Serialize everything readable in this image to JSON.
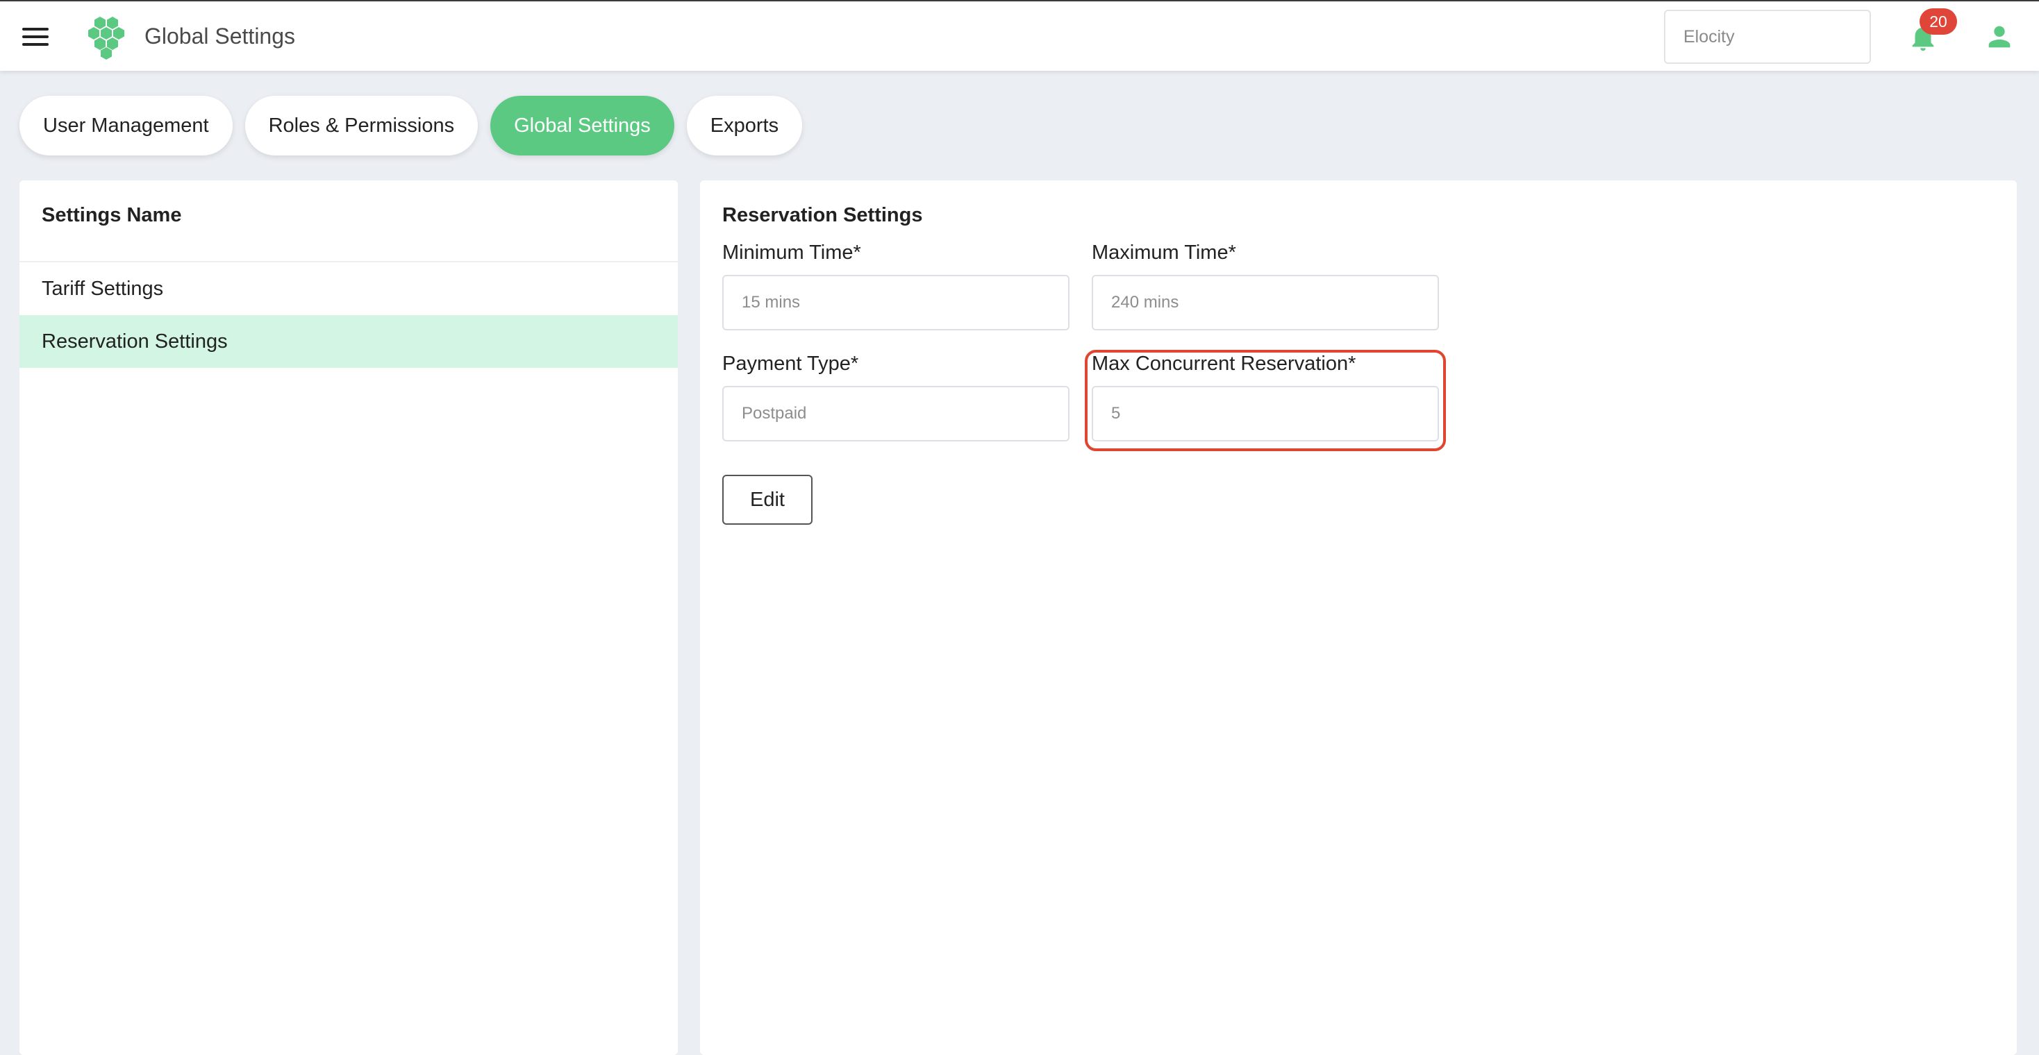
{
  "header": {
    "app_title": "Global Settings",
    "org_selector_value": "Elocity",
    "notification_count": "20",
    "brand_color": "#5cc983",
    "badge_color": "#e0453a",
    "icons": [
      "menu-icon",
      "logo-icon",
      "bell-icon",
      "user-icon"
    ]
  },
  "tabs": [
    {
      "label": "User Management",
      "active": false
    },
    {
      "label": "Roles & Permissions",
      "active": false
    },
    {
      "label": "Global Settings",
      "active": true
    },
    {
      "label": "Exports",
      "active": false
    }
  ],
  "settings_list": {
    "header": "Settings Name",
    "items": [
      {
        "label": "Tariff Settings",
        "selected": false
      },
      {
        "label": "Reservation Settings",
        "selected": true
      }
    ]
  },
  "reservation": {
    "title": "Reservation Settings",
    "fields": {
      "min_time": {
        "label": "Minimum Time*",
        "value": "15 mins"
      },
      "max_time": {
        "label": "Maximum Time*",
        "value": "240 mins"
      },
      "payment_type": {
        "label": "Payment Type*",
        "value": "Postpaid"
      },
      "max_concurrent": {
        "label": "Max Concurrent Reservation*",
        "value": "5",
        "highlighted": true
      }
    },
    "edit_label": "Edit"
  }
}
